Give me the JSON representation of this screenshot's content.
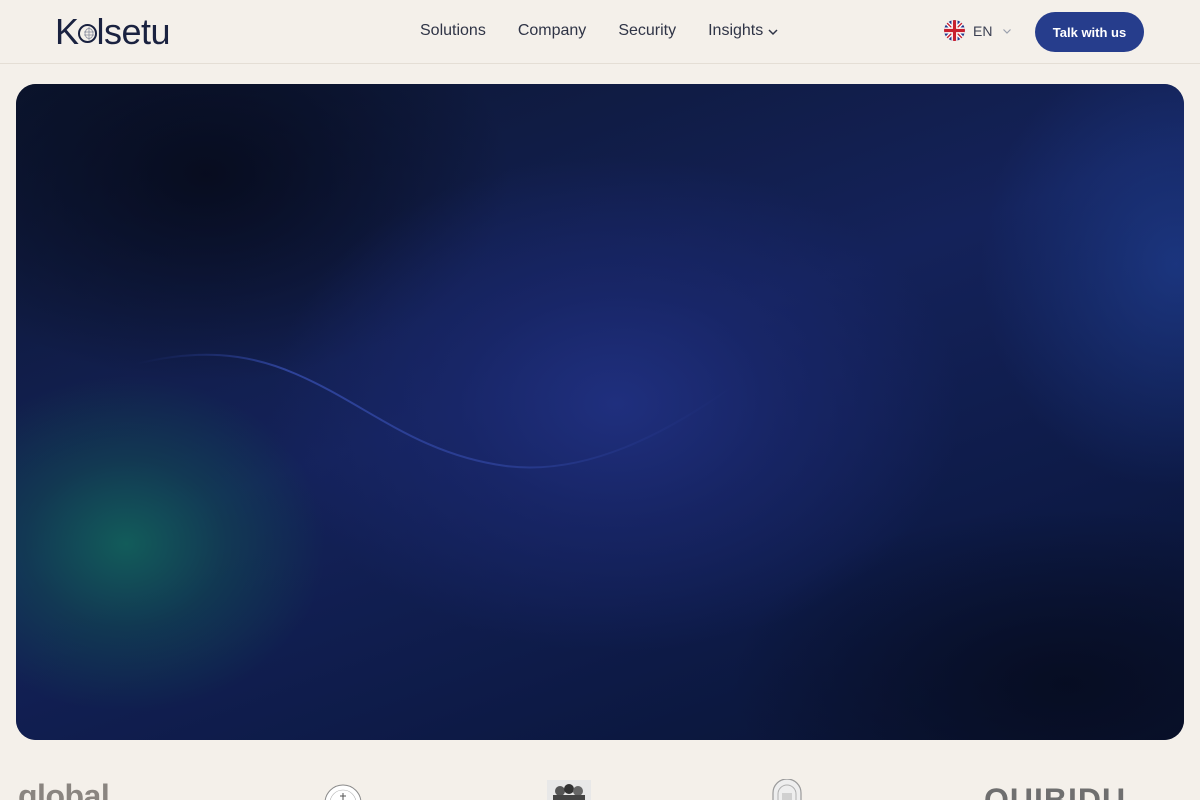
{
  "header": {
    "logo_text_start": "K",
    "logo_text_end": "lsetu",
    "nav": [
      {
        "label": "Solutions"
      },
      {
        "label": "Company"
      },
      {
        "label": "Security"
      },
      {
        "label": "Insights",
        "has_dropdown": true
      }
    ],
    "language": {
      "code": "EN",
      "flag": "uk-flag-icon"
    },
    "cta_label": "Talk with us"
  },
  "colors": {
    "page_background": "#f4f0ea",
    "brand_navy": "#1a2240",
    "cta_background": "#263d8c",
    "hero_dark": "#0b1430",
    "hero_blue": "#1a2a78",
    "hero_teal": "#125f5a"
  },
  "partners": {
    "items": [
      {
        "name": "global",
        "text": "global"
      },
      {
        "name": "circular-seal",
        "text": ""
      },
      {
        "name": "group-photo",
        "text": ""
      },
      {
        "name": "arch-emblem",
        "text": ""
      },
      {
        "name": "quibidu",
        "text": "QUIBIDU"
      }
    ]
  }
}
